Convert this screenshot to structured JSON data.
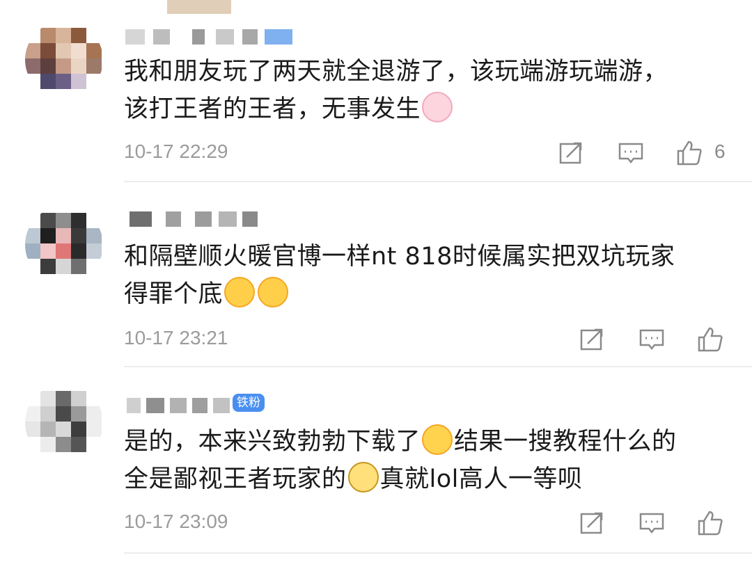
{
  "comments": [
    {
      "content": "我和朋友玩了两天就全退游了，该玩端游玩端游，该打王者的王者，无事发生",
      "line1": "我和朋友玩了两天就全退游了，该玩端游玩端游，",
      "line2": "该打王者的王者，无事发生",
      "emoji_after": "bunny-emoji",
      "time": "10-17 22:29",
      "likes": "6"
    },
    {
      "content": "和隔壁顺火暖官博一样nt 818时候属实把双坑玩家得罪个底",
      "line1": "和隔壁顺火暖官博一样nt 818时候属实把双坑玩家",
      "line2": "得罪个底",
      "emoji_after": "yum-emoji",
      "time": "10-17 23:21",
      "likes": ""
    },
    {
      "badge": "铁粉",
      "content": "是的，本来兴致勃勃下载了结果一搜教程什么的全是鄙视王者玩家的真就lol高人一等呗",
      "line1a": "是的，本来兴致勃勃下载了",
      "line1b": "结果一搜教程什么的",
      "line2a": "全是鄙视王者玩家的",
      "line2b": "真就lol高人一等呗",
      "time": "10-17 23:09",
      "likes": ""
    }
  ],
  "icons": {
    "share": "share-icon",
    "reply": "comment-icon",
    "like": "thumbs-up-icon"
  },
  "colors": {
    "text": "#1a1a1a",
    "time": "#9b9b9b",
    "badge": "#4a8ff0",
    "divider": "#ececec"
  }
}
